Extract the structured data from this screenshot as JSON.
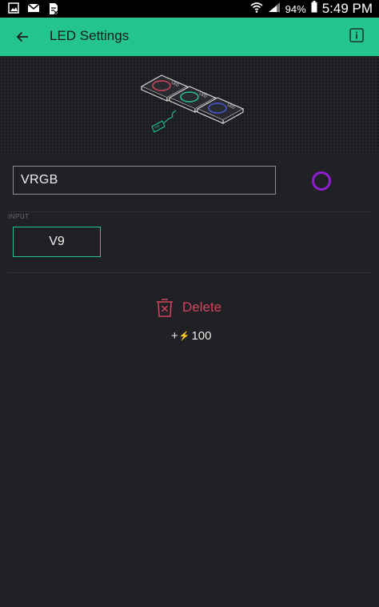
{
  "statusbar": {
    "battery": "94%",
    "time": "5:49 PM"
  },
  "appbar": {
    "title": "LED Settings"
  },
  "illustration": {
    "led_labels": [
      "LED",
      "LED",
      "LED"
    ],
    "pin_label": "PIN"
  },
  "widget": {
    "name": "VRGB",
    "color": "#8e1fd1"
  },
  "input": {
    "label": "INPUT",
    "pin": "V9"
  },
  "actions": {
    "delete_label": "Delete"
  },
  "energy": {
    "prefix": "+",
    "value": "100"
  },
  "colors": {
    "accent": "#23c48e",
    "danger": "#d3435c",
    "background": "#202125"
  }
}
